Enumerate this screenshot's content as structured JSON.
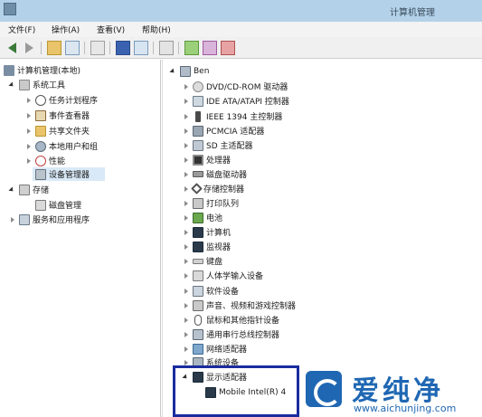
{
  "window": {
    "title": "计算机管理"
  },
  "menu": [
    "文件(F)",
    "操作(A)",
    "查看(V)",
    "帮助(H)"
  ],
  "left_tree": [
    {
      "label": "计算机管理(本地)",
      "icon": "computer-management-icon",
      "level": 0,
      "state": "none"
    },
    {
      "label": "系统工具",
      "icon": "tools-icon",
      "level": 1,
      "state": "open"
    },
    {
      "label": "任务计划程序",
      "icon": "clock-icon",
      "level": 2,
      "state": "closed"
    },
    {
      "label": "事件查看器",
      "icon": "event-viewer-icon",
      "level": 2,
      "state": "closed"
    },
    {
      "label": "共享文件夹",
      "icon": "shared-folder-icon",
      "level": 2,
      "state": "closed"
    },
    {
      "label": "本地用户和组",
      "icon": "users-icon",
      "level": 2,
      "state": "closed"
    },
    {
      "label": "性能",
      "icon": "performance-icon",
      "level": 2,
      "state": "closed"
    },
    {
      "label": "设备管理器",
      "icon": "device-manager-icon",
      "level": 2,
      "state": "none",
      "selected": true
    },
    {
      "label": "存储",
      "icon": "storage-icon",
      "level": 1,
      "state": "open"
    },
    {
      "label": "磁盘管理",
      "icon": "disk-management-icon",
      "level": 2,
      "state": "none"
    },
    {
      "label": "服务和应用程序",
      "icon": "services-icon",
      "level": 1,
      "state": "closed"
    }
  ],
  "device_tree": {
    "root": "Ben",
    "categories": [
      {
        "label": "DVD/CD-ROM 驱动器",
        "icon": "dvd-drive-icon"
      },
      {
        "label": "IDE ATA/ATAPI 控制器",
        "icon": "ide-controller-icon"
      },
      {
        "label": "IEEE 1394 主控制器",
        "icon": "ieee1394-icon"
      },
      {
        "label": "PCMCIA 适配器",
        "icon": "pcmcia-icon"
      },
      {
        "label": "SD 主适配器",
        "icon": "sd-adapter-icon"
      },
      {
        "label": "处理器",
        "icon": "processor-icon"
      },
      {
        "label": "磁盘驱动器",
        "icon": "disk-drive-icon"
      },
      {
        "label": "存储控制器",
        "icon": "storage-controller-icon"
      },
      {
        "label": "打印队列",
        "icon": "printer-icon"
      },
      {
        "label": "电池",
        "icon": "battery-icon"
      },
      {
        "label": "计算机",
        "icon": "computer-icon"
      },
      {
        "label": "监视器",
        "icon": "monitor-icon"
      },
      {
        "label": "键盘",
        "icon": "keyboard-icon"
      },
      {
        "label": "人体学输入设备",
        "icon": "hid-icon"
      },
      {
        "label": "软件设备",
        "icon": "software-device-icon"
      },
      {
        "label": "声音、视频和游戏控制器",
        "icon": "sound-icon"
      },
      {
        "label": "鼠标和其他指针设备",
        "icon": "mouse-icon"
      },
      {
        "label": "通用串行总线控制器",
        "icon": "usb-icon"
      },
      {
        "label": "网络适配器",
        "icon": "network-adapter-icon"
      },
      {
        "label": "系统设备",
        "icon": "system-device-icon"
      },
      {
        "label": "显示适配器",
        "icon": "display-adapter-icon",
        "expanded": true
      },
      {
        "label": "Mobile Intel(R) 4",
        "icon": "display-device-icon",
        "child": true
      }
    ]
  },
  "watermark": {
    "title": "爱纯净",
    "url": "www.aichunjing.com"
  },
  "colors": {
    "titlebar": "#b3d2ea",
    "highlight_border": "#1a2c9e",
    "watermark_blue": "#1f67b3",
    "selection": "#d9e9f7"
  }
}
